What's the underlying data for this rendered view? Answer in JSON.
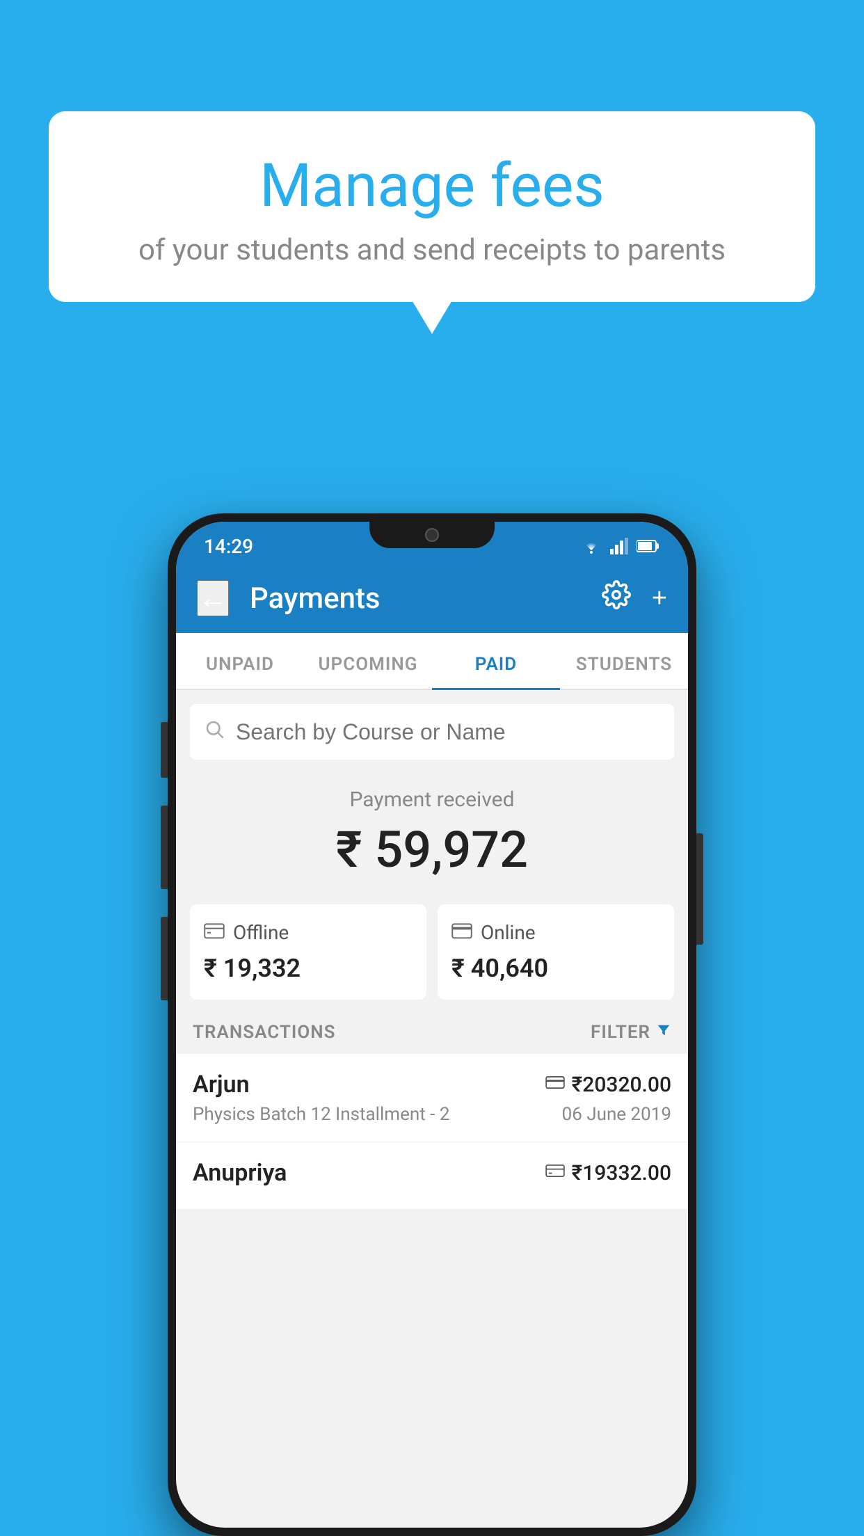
{
  "bubble": {
    "title": "Manage fees",
    "subtitle": "of your students and send receipts to parents"
  },
  "statusBar": {
    "time": "14:29",
    "icons": [
      "wifi",
      "signal",
      "battery"
    ]
  },
  "appBar": {
    "title": "Payments",
    "backLabel": "←",
    "gearLabel": "⚙",
    "plusLabel": "+"
  },
  "tabs": [
    {
      "label": "UNPAID",
      "active": false
    },
    {
      "label": "UPCOMING",
      "active": false
    },
    {
      "label": "PAID",
      "active": true
    },
    {
      "label": "STUDENTS",
      "active": false
    }
  ],
  "search": {
    "placeholder": "Search by Course or Name"
  },
  "paymentReceived": {
    "label": "Payment received",
    "amount": "₹ 59,972"
  },
  "paymentCards": [
    {
      "label": "Offline",
      "amount": "₹ 19,332",
      "icon": "💳"
    },
    {
      "label": "Online",
      "amount": "₹ 40,640",
      "icon": "💳"
    }
  ],
  "transactions": {
    "header": "TRANSACTIONS",
    "filterLabel": "FILTER",
    "rows": [
      {
        "name": "Arjun",
        "course": "Physics Batch 12 Installment - 2",
        "amount": "₹20320.00",
        "date": "06 June 2019",
        "paymentType": "card"
      },
      {
        "name": "Anupriya",
        "course": "",
        "amount": "₹19332.00",
        "date": "",
        "paymentType": "offline"
      }
    ]
  }
}
